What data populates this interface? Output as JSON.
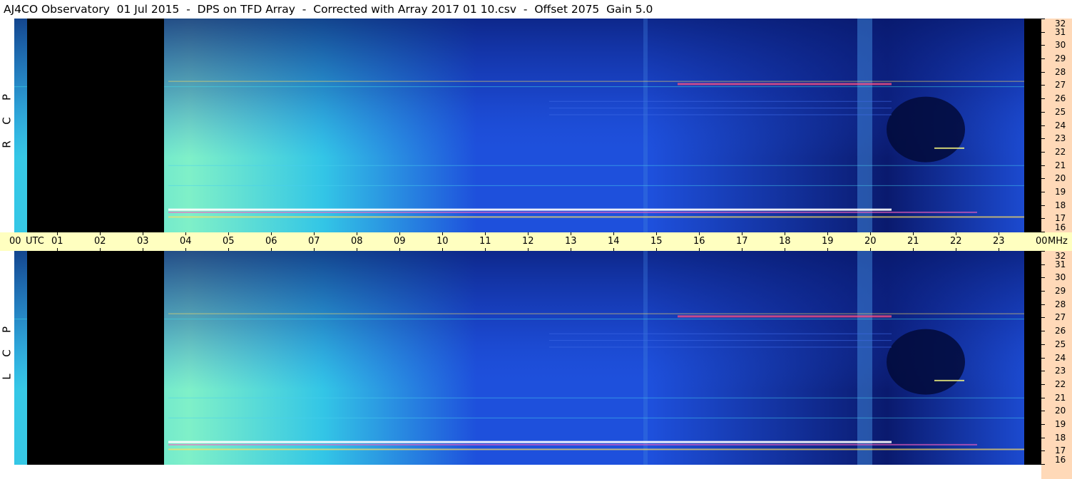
{
  "title": "AJ4CO Observatory  01 Jul 2015  -  DPS on TFD Array  -  Corrected with Array 2017 01 10.csv  -  Offset 2075  Gain 5.0",
  "chart_data": [
    {
      "type": "heatmap",
      "panel": "RCP",
      "ylabel": "R C P",
      "x_hours": [
        0,
        24
      ],
      "y_mhz": [
        16,
        32
      ],
      "ylim": [
        16,
        32
      ],
      "blank_utc": [
        0.3,
        3.5
      ]
    },
    {
      "type": "heatmap",
      "panel": "LCP",
      "ylabel": "L C P",
      "x_hours": [
        0,
        24
      ],
      "y_mhz": [
        16,
        32
      ],
      "ylim": [
        16,
        32
      ],
      "blank_utc": [
        0.3,
        3.5
      ]
    }
  ],
  "time_axis": {
    "start_label": "00",
    "utc_label": "UTC",
    "labels": [
      "01",
      "02",
      "03",
      "04",
      "05",
      "06",
      "07",
      "08",
      "09",
      "10",
      "11",
      "12",
      "13",
      "14",
      "15",
      "16",
      "17",
      "18",
      "19",
      "20",
      "21",
      "22",
      "23"
    ],
    "end_label": "00",
    "unit_label": "MHz"
  },
  "freq_axis": {
    "labels": [
      "32",
      "31",
      "30",
      "29",
      "28",
      "27",
      "26",
      "25",
      "24",
      "23",
      "22",
      "21",
      "20",
      "19",
      "18",
      "17",
      "16"
    ]
  },
  "colors": {
    "time_bar": "#ffffc0",
    "freq_bar": "#ffd9b8",
    "blank": "#000000",
    "deep": "#0a1a6e",
    "mid": "#1e50dc",
    "light": "#33c6e6",
    "bright": "#7ff0c8"
  }
}
